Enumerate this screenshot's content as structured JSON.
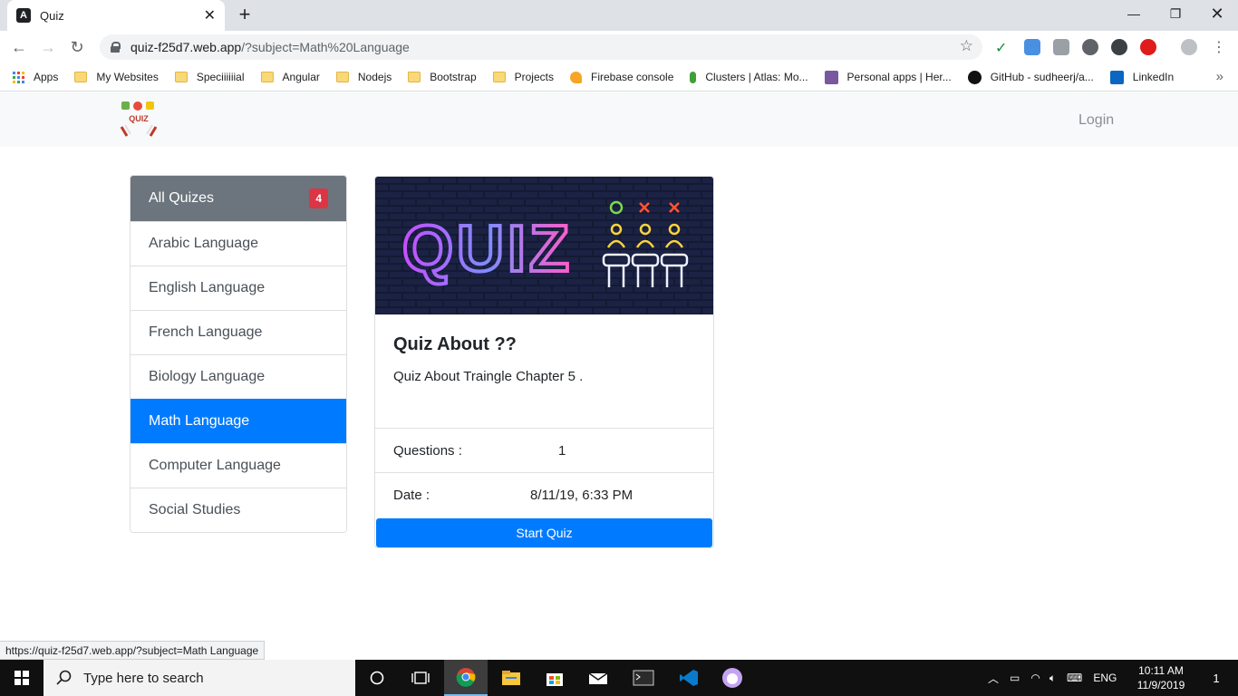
{
  "browser": {
    "tab_title": "Quiz",
    "url_host": "quiz-f25d7.web.app",
    "url_path": "/?subject=Math%20Language",
    "status_url": "https://quiz-f25d7.web.app/?subject=Math Language",
    "bookmarks": [
      {
        "label": "Apps",
        "icon": "apps-grid-icon"
      },
      {
        "label": "My Websites",
        "icon": "folder-icon"
      },
      {
        "label": "Speciiiiiial",
        "icon": "folder-icon"
      },
      {
        "label": "Angular",
        "icon": "folder-icon"
      },
      {
        "label": "Nodejs",
        "icon": "folder-icon"
      },
      {
        "label": "Bootstrap",
        "icon": "folder-icon"
      },
      {
        "label": "Projects",
        "icon": "folder-icon"
      },
      {
        "label": "Firebase console",
        "icon": "firebase-icon"
      },
      {
        "label": "Clusters | Atlas: Mo...",
        "icon": "mongodb-leaf-icon"
      },
      {
        "label": "Personal apps | Her...",
        "icon": "heroku-icon"
      },
      {
        "label": "GitHub - sudheerj/a...",
        "icon": "github-icon"
      },
      {
        "label": "LinkedIn",
        "icon": "linkedin-icon"
      }
    ]
  },
  "header": {
    "logo_text": "QUIZ",
    "login_label": "Login"
  },
  "sidebar": {
    "header_label": "All Quizes",
    "count_badge": "4",
    "items": [
      {
        "label": "Arabic Language",
        "active": false
      },
      {
        "label": "English Language",
        "active": false
      },
      {
        "label": "French Language",
        "active": false
      },
      {
        "label": "Biology Language",
        "active": false
      },
      {
        "label": "Math Language",
        "active": true
      },
      {
        "label": "Computer Language",
        "active": false
      },
      {
        "label": "Social Studies",
        "active": false
      }
    ]
  },
  "card": {
    "banner_text": "QUIZ",
    "title": "Quiz About ??",
    "description": "Quiz About Traingle Chapter 5 .",
    "questions_label": "Questions :",
    "questions_value": "1",
    "date_label": "Date :",
    "date_value": "8/11/19, 6:33 PM",
    "start_label": "Start Quiz"
  },
  "taskbar": {
    "search_placeholder": "Type here to search",
    "language": "ENG",
    "time": "10:11 AM",
    "date": "11/9/2019",
    "notification_count": "1"
  },
  "colors": {
    "primary": "#007bff",
    "secondary": "#6c757d",
    "danger": "#dc3545",
    "header_bg": "#f8f9fa"
  }
}
